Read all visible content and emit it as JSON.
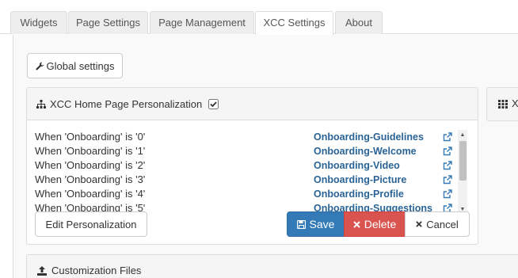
{
  "tabs": [
    {
      "label": "Widgets"
    },
    {
      "label": "Page Settings"
    },
    {
      "label": "Page Management"
    },
    {
      "label": "XCC Settings"
    },
    {
      "label": "About"
    }
  ],
  "global_settings_label": "Global settings",
  "personalization": {
    "title": "XCC Home Page Personalization",
    "checked": true,
    "rows": [
      {
        "condition": "When 'Onboarding' is '0'",
        "page": "Onboarding-Guidelines"
      },
      {
        "condition": "When 'Onboarding' is '1'",
        "page": "Onboarding-Welcome"
      },
      {
        "condition": "When 'Onboarding' is '2'",
        "page": "Onboarding-Video"
      },
      {
        "condition": "When 'Onboarding' is '3'",
        "page": "Onboarding-Picture"
      },
      {
        "condition": "When 'Onboarding' is '4'",
        "page": "Onboarding-Profile"
      },
      {
        "condition": "When 'Onboarding' is '5'",
        "page": "Onboarding-Suggestions"
      }
    ],
    "edit_label": "Edit Personalization",
    "save_label": "Save",
    "delete_label": "Delete",
    "cancel_label": "Cancel"
  },
  "right_panel_title": "X",
  "customization_files_title": "Customization Files",
  "colors": {
    "link": "#2a6496",
    "save": "#337ab7",
    "delete": "#d9534f"
  }
}
